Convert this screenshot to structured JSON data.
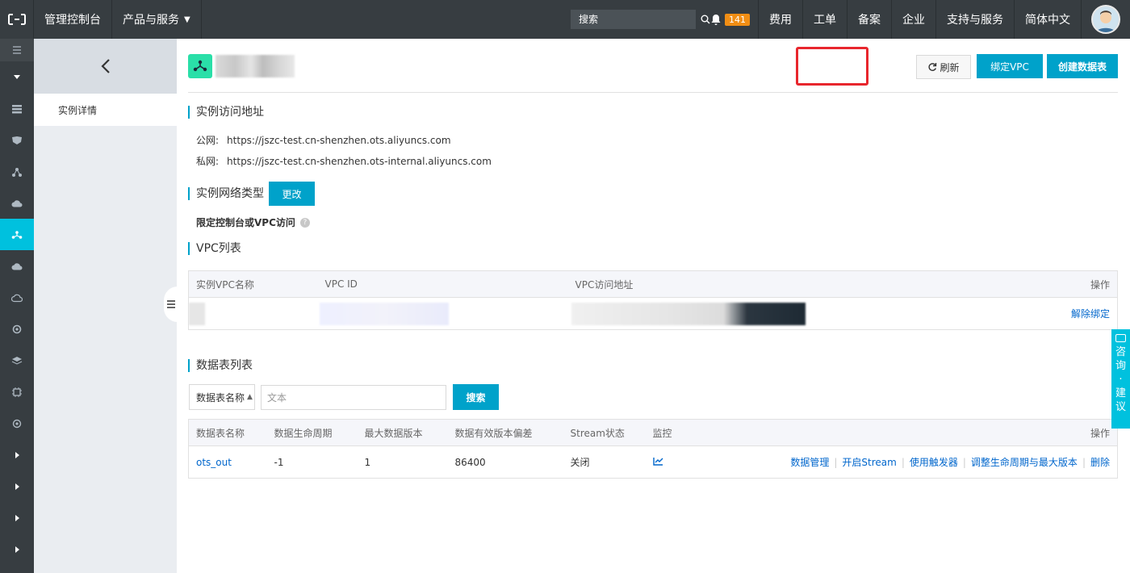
{
  "topbar": {
    "console": "管理控制台",
    "products": "产品与服务",
    "search_placeholder": "搜索",
    "notification_count": "141",
    "nav": [
      "费用",
      "工单",
      "备案",
      "企业",
      "支持与服务",
      "简体中文"
    ]
  },
  "sidebar": {
    "sub_items": [
      "实例详情"
    ]
  },
  "header": {
    "refresh_label": "刷新",
    "bind_vpc_label": "绑定VPC",
    "create_table_label": "创建数据表"
  },
  "access": {
    "title": "实例访问地址",
    "public_label": "公网:",
    "public_url": "https://jszc-test.cn-shenzhen.ots.aliyuncs.com",
    "private_label": "私网:",
    "private_url": "https://jszc-test.cn-shenzhen.ots-internal.aliyuncs.com"
  },
  "network": {
    "title": "实例网络类型",
    "change_label": "更改",
    "restriction": "限定控制台或VPC访问"
  },
  "vpc": {
    "title": "VPC列表",
    "columns": [
      "实例VPC名称",
      "VPC ID",
      "VPC访问地址",
      "操作"
    ],
    "unbind_label": "解除绑定"
  },
  "tables": {
    "title": "数据表列表",
    "filter_select": "数据表名称",
    "filter_placeholder": "文本",
    "search_label": "搜索",
    "columns": [
      "数据表名称",
      "数据生命周期",
      "最大数据版本",
      "数据有效版本偏差",
      "Stream状态",
      "监控",
      "操作"
    ],
    "rows": [
      {
        "name": "ots_out",
        "ttl": "-1",
        "max_versions": "1",
        "deviation": "86400",
        "stream": "关闭",
        "actions": [
          "数据管理",
          "开启Stream",
          "使用触发器",
          "调整生命周期与最大版本",
          "删除"
        ]
      }
    ]
  },
  "consult": {
    "chars": [
      "咨",
      "询",
      "·",
      "建",
      "议"
    ]
  },
  "colors": {
    "topbar": "#373d41",
    "accent": "#00a2ca",
    "active": "#00c1de",
    "highlight": "#e8262d",
    "link": "#0066cc"
  }
}
